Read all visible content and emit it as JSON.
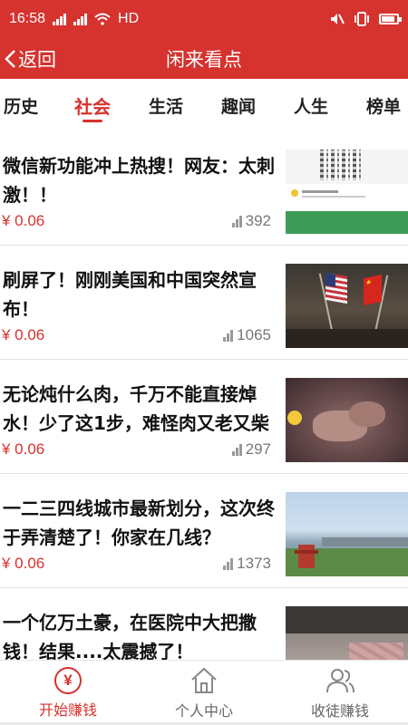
{
  "status_bar": {
    "time": "16:58",
    "network": "HD"
  },
  "header": {
    "back_label": "返回",
    "title": "闲来看点"
  },
  "tabs": [
    {
      "label": "历史",
      "active": false
    },
    {
      "label": "社会",
      "active": true
    },
    {
      "label": "生活",
      "active": false
    },
    {
      "label": "趣闻",
      "active": false
    },
    {
      "label": "人生",
      "active": false
    },
    {
      "label": "榜单",
      "active": false
    }
  ],
  "articles": [
    {
      "title": "微信新功能冲上热搜！网友：太刺激！！",
      "reward": "¥ 0.06",
      "views": "392",
      "thumb": "wechat-screenshot"
    },
    {
      "title": "刷屏了！刚刚美国和中国突然宣布！",
      "reward": "¥ 0.06",
      "views": "1065",
      "thumb": "us-china-flags"
    },
    {
      "title": "无论炖什么肉，千万不能直接焯水！少了这1步，难怪肉又老又柴",
      "reward": "¥ 0.06",
      "views": "297",
      "thumb": "boiling-meat"
    },
    {
      "title": "一二三四线城市最新划分，这次终于弄清楚了！你家在几线？",
      "reward": "¥ 0.06",
      "views": "1373",
      "thumb": "city-lakeside"
    },
    {
      "title": "一个亿万土豪，在医院中大把撒钱！结果....太震撼了！",
      "reward": "",
      "views": "",
      "thumb": "hospital-money"
    }
  ],
  "bottom_nav": [
    {
      "label": "开始赚钱",
      "icon": "yen-coin-icon",
      "active": true
    },
    {
      "label": "个人中心",
      "icon": "home-icon",
      "active": false
    },
    {
      "label": "收徒赚钱",
      "icon": "users-icon",
      "active": false
    }
  ],
  "colors": {
    "brand_red": "#d6322e",
    "text_gray": "#777777"
  }
}
